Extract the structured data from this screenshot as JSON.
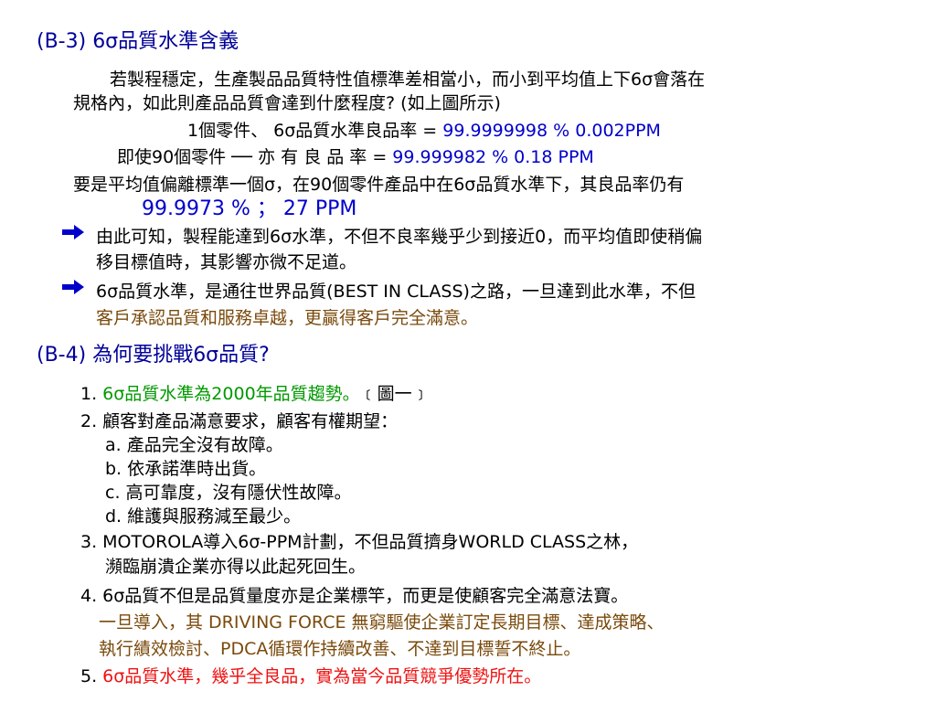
{
  "section_b3": {
    "heading": "(B-3) 6σ品質水準含義",
    "line1": "若製程穩定，生產製品品質特性值標準差相當小，而小到平均值上下6σ會落在",
    "line2": "規格內，如此則產品品質會達到什麼程度?  (如上圖所示)",
    "line3_label": "1個零件、 6σ品質水準良品率  = ",
    "line3_value": "99.9999998 %       0.002PPM",
    "line4_label": "即使90個零件    ──   亦 有 良 品 率  = ",
    "line4_value": "99.999982   %        0.18  PPM",
    "line5": "要是平均值偏離標準一個σ，在90個零件產品中在6σ品質水準下，其良品率仍有",
    "line6": "99.9973  %   ；  27  PPM",
    "bullet1_line1": "由此可知，製程能達到6σ水準，不但不良率幾乎少到接近0，而平均值即使稍偏",
    "bullet1_line2": "移目標值時，其影響亦微不足道。",
    "bullet2_line1": "6σ品質水準，是通往世界品質(BEST IN CLASS)之路，一旦達到此水準，不但",
    "bullet2_line2": "客戶承認品質和服務卓越，更贏得客戶完全滿意。"
  },
  "section_b4": {
    "heading_prefix": "(B-4) ",
    "heading_rest": "為何要挑戰6σ品質?",
    "item1_num": "1. ",
    "item1_text": "6σ品質水準為2000年品質趨勢。",
    "item1_note": "﹝圖一﹞",
    "item2": "2. 顧客對產品滿意要求，顧客有權期望：",
    "item2_a": "a. 產品完全沒有故障。",
    "item2_b": "b. 依承諾準時出貨。",
    "item2_c": "c. 高可靠度，沒有隱伏性故障。",
    "item2_d": "d. 維護與服務減至最少。",
    "item3_line1": "3. MOTOROLA導入6σ-PPM計劃，不但品質擠身WORLD CLASS之林，",
    "item3_line2": "瀕臨崩潰企業亦得以此起死回生。",
    "item4_line1": "4. 6σ品質不但是品質量度亦是企業標竿，而更是使顧客完全滿意法寶。",
    "item4_line2_prefix": "一旦導入，其  DRIVING FORCE  ",
    "item4_line2_rest": "無窮驅使企業訂定長期目標、達成策略、",
    "item4_line3": "執行績效檢討、PDCA循環作持續改善、不達到目標誓不終止。",
    "item5_num": "5. ",
    "item5_text": "6σ品質水準，幾乎全良品，實為當今品質競爭優勢所在。"
  },
  "colors": {
    "heading": "#00009a",
    "value_blue": "#0000cc",
    "green": "#009900",
    "brown": "#7a4a0c",
    "red": "#ee1111"
  },
  "icons": [
    "arrow-right-icon",
    "arrow-right-icon"
  ]
}
